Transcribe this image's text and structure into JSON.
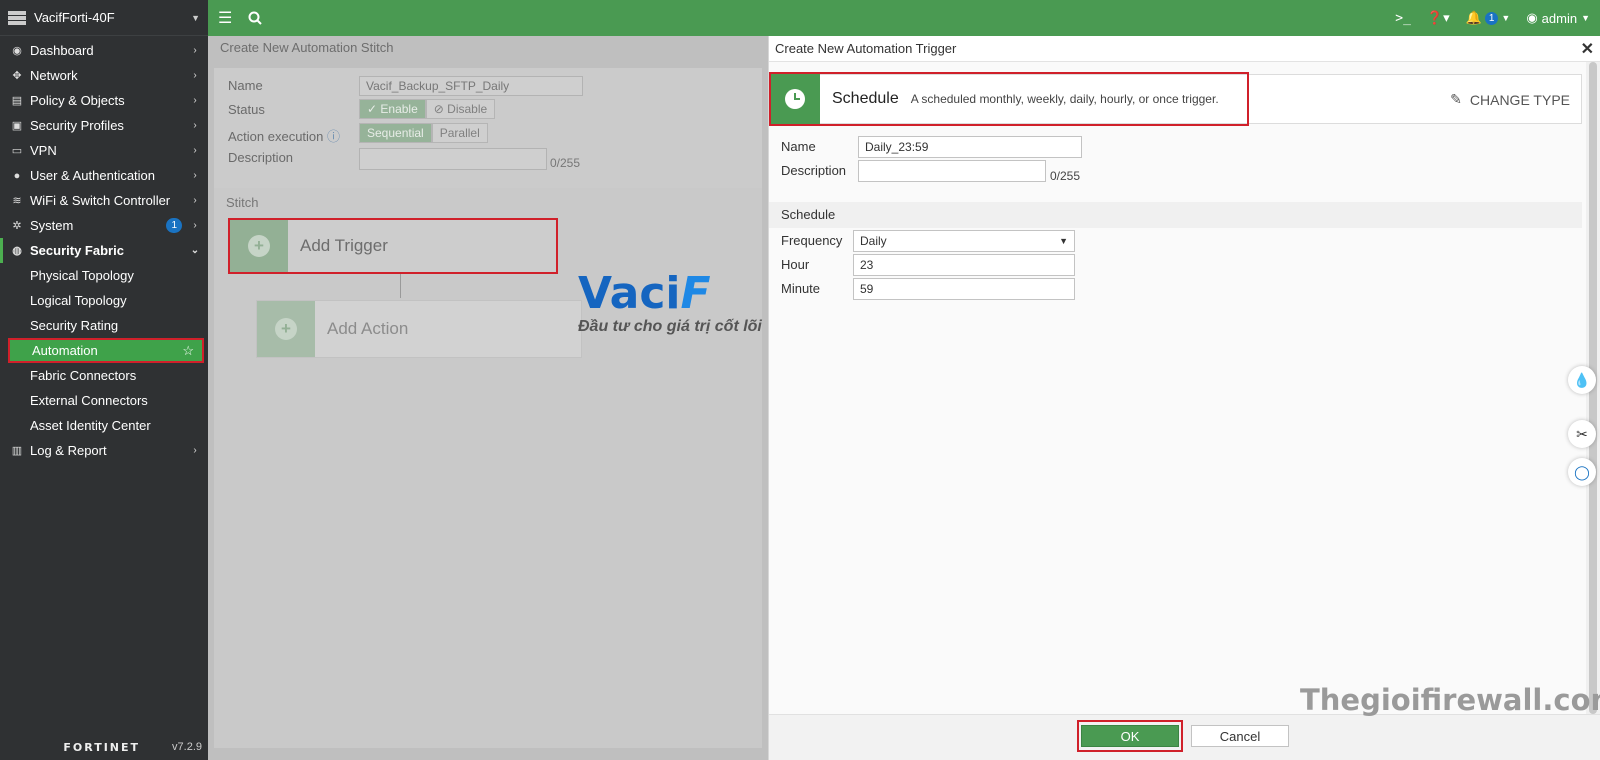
{
  "sidebar": {
    "device_name": "VacifForti-40F",
    "items": [
      {
        "label": "Dashboard"
      },
      {
        "label": "Network"
      },
      {
        "label": "Policy & Objects"
      },
      {
        "label": "Security Profiles"
      },
      {
        "label": "VPN"
      },
      {
        "label": "User & Authentication"
      },
      {
        "label": "WiFi & Switch Controller"
      },
      {
        "label": "System",
        "badge": "1"
      },
      {
        "label": "Security Fabric"
      },
      {
        "label": "Log & Report"
      }
    ],
    "sub_items": [
      {
        "label": "Physical Topology"
      },
      {
        "label": "Logical Topology"
      },
      {
        "label": "Security Rating"
      },
      {
        "label": "Automation"
      },
      {
        "label": "Fabric Connectors"
      },
      {
        "label": "External Connectors"
      },
      {
        "label": "Asset Identity Center"
      }
    ],
    "brand": "FORTINET",
    "version": "v7.2.9"
  },
  "topbar": {
    "notification_count": "1",
    "user": "admin"
  },
  "stitch_page": {
    "title": "Create New Automation Stitch",
    "name_label": "Name",
    "name_value": "Vacif_Backup_SFTP_Daily",
    "status_label": "Status",
    "enable_label": "Enable",
    "disable_label": "Disable",
    "action_exec_label": "Action execution",
    "sequential_label": "Sequential",
    "parallel_label": "Parallel",
    "description_label": "Description",
    "desc_counter": "0/255",
    "stitch_label": "Stitch",
    "add_trigger": "Add Trigger",
    "add_action": "Add Action"
  },
  "watermark": {
    "brand_main": "Vaci",
    "brand_accent": "F",
    "slogan": "Đầu tư cho giá trị cốt lõi",
    "site": "Thegioifirewall.com"
  },
  "trigger_panel": {
    "title": "Create New Automation Trigger",
    "close": "✕",
    "type_name": "Schedule",
    "type_desc": "A scheduled monthly, weekly, daily, hourly, or once trigger.",
    "change_type": "CHANGE TYPE",
    "name_label": "Name",
    "name_value": "Daily_23:59",
    "description_label": "Description",
    "desc_counter": "0/255",
    "section_title": "Schedule",
    "frequency_label": "Frequency",
    "frequency_value": "Daily",
    "hour_label": "Hour",
    "hour_value": "23",
    "minute_label": "Minute",
    "minute_value": "59",
    "ok_label": "OK",
    "cancel_label": "Cancel"
  },
  "colors": {
    "accent_green": "#4a9a52",
    "highlight_red": "#d0202a",
    "sidebar_bg": "#2f3133",
    "badge_blue": "#1a73c2"
  }
}
